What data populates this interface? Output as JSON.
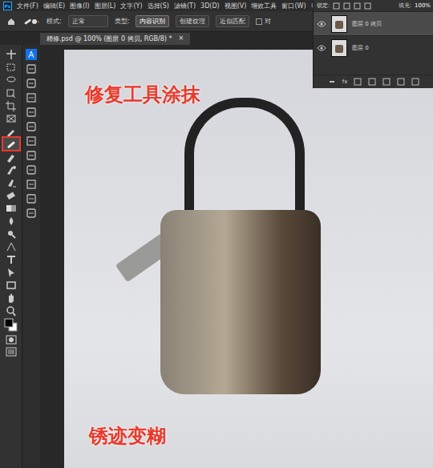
{
  "app_logo": "Ps",
  "menu": [
    "文件(F)",
    "编辑(E)",
    "图像(I)",
    "图层(L)",
    "文字(Y)",
    "选择(S)",
    "滤镜(T)",
    "3D(D)",
    "视图(V)",
    "增效工具",
    "窗口(W)",
    "帮助(H)"
  ],
  "options": {
    "mode_label": "模式:",
    "mode": "正常",
    "type_label": "类型:",
    "types": [
      {
        "label": "内容识别",
        "selected": true
      },
      {
        "label": "创建纹理",
        "selected": false
      },
      {
        "label": "近似匹配",
        "selected": false
      }
    ],
    "align": {
      "label": "对",
      "checked": false
    }
  },
  "document_tab": {
    "title": "精修.psd @ 100% (图层 0 拷贝, RGB/8) *",
    "close": "×"
  },
  "tools": [
    {
      "selected": false
    },
    {
      "selected": false
    },
    {
      "selected": false
    },
    {
      "selected": false
    },
    {
      "selected": false
    },
    {
      "selected": false
    },
    {
      "selected": false
    },
    {
      "selected": true
    },
    {
      "selected": false
    },
    {
      "selected": false
    },
    {
      "selected": false
    },
    {
      "selected": false
    },
    {
      "selected": false
    },
    {
      "selected": false
    },
    {
      "selected": false
    },
    {
      "selected": false
    },
    {
      "selected": false
    },
    {
      "selected": false
    },
    {
      "selected": false
    },
    {
      "selected": false
    },
    {
      "selected": false
    }
  ],
  "layers_panel": {
    "lock_label": "锁定:",
    "fill_label": "填充:",
    "fill": "100%",
    "fx": "fx",
    "layers": [
      {
        "name": "图层 0 拷贝",
        "visible": true,
        "selected": true
      },
      {
        "name": "图层 0",
        "visible": true,
        "selected": false
      }
    ]
  },
  "annotations": [
    "修复工具涂抹",
    "锈迹变糊"
  ]
}
